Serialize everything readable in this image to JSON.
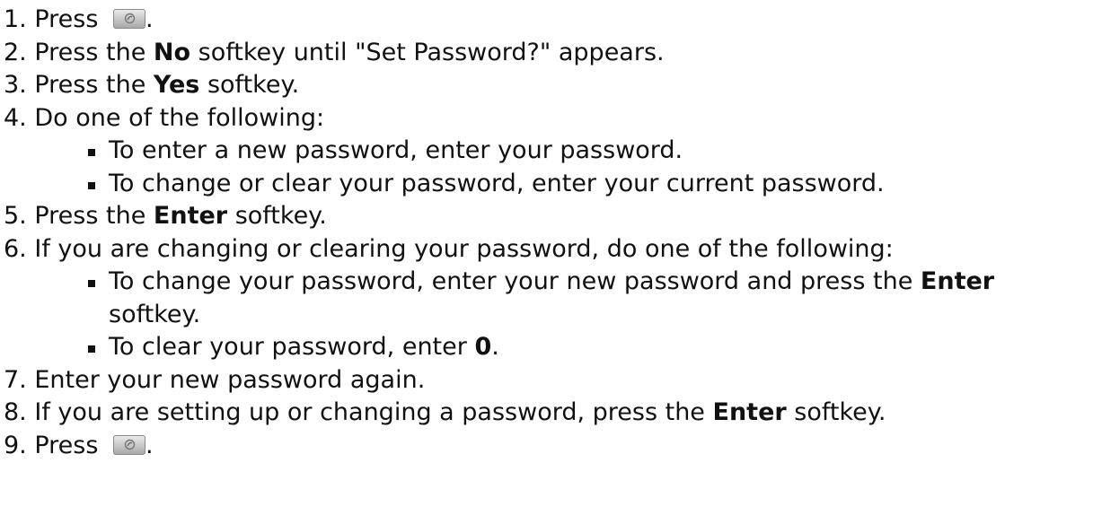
{
  "steps": [
    {
      "num": "1.",
      "pre": "Press",
      "post": "."
    },
    {
      "num": "2.",
      "pre": "Press the ",
      "bold": "No",
      "post": " softkey until \"Set Password?\" appears."
    },
    {
      "num": "3.",
      "pre": "Press the ",
      "bold": "Yes",
      "post": " softkey."
    },
    {
      "num": "4.",
      "text": "Do one of the following:",
      "subs": [
        "To enter a new password, enter your password.",
        "To change or clear your password, enter your current password."
      ]
    },
    {
      "num": "5.",
      "pre": "Press the ",
      "bold": "Enter",
      "post": " softkey."
    },
    {
      "num": "6.",
      "text": "If you are changing or clearing your password, do one of the following:",
      "subs": [
        {
          "pre": "To change your password, enter your new password and press the ",
          "bold": "Enter",
          "post": " softkey."
        },
        {
          "pre": "To clear your password, enter ",
          "bold": "0",
          "post": "."
        }
      ]
    },
    {
      "num": "7.",
      "text": "Enter your new password again."
    },
    {
      "num": "8.",
      "pre": "If you are setting up or changing a password, press the ",
      "bold": "Enter",
      "post": " softkey."
    },
    {
      "num": "9.",
      "pre": "Press",
      "post": "."
    }
  ],
  "icons": {
    "phone_key": "phone-key-icon"
  }
}
